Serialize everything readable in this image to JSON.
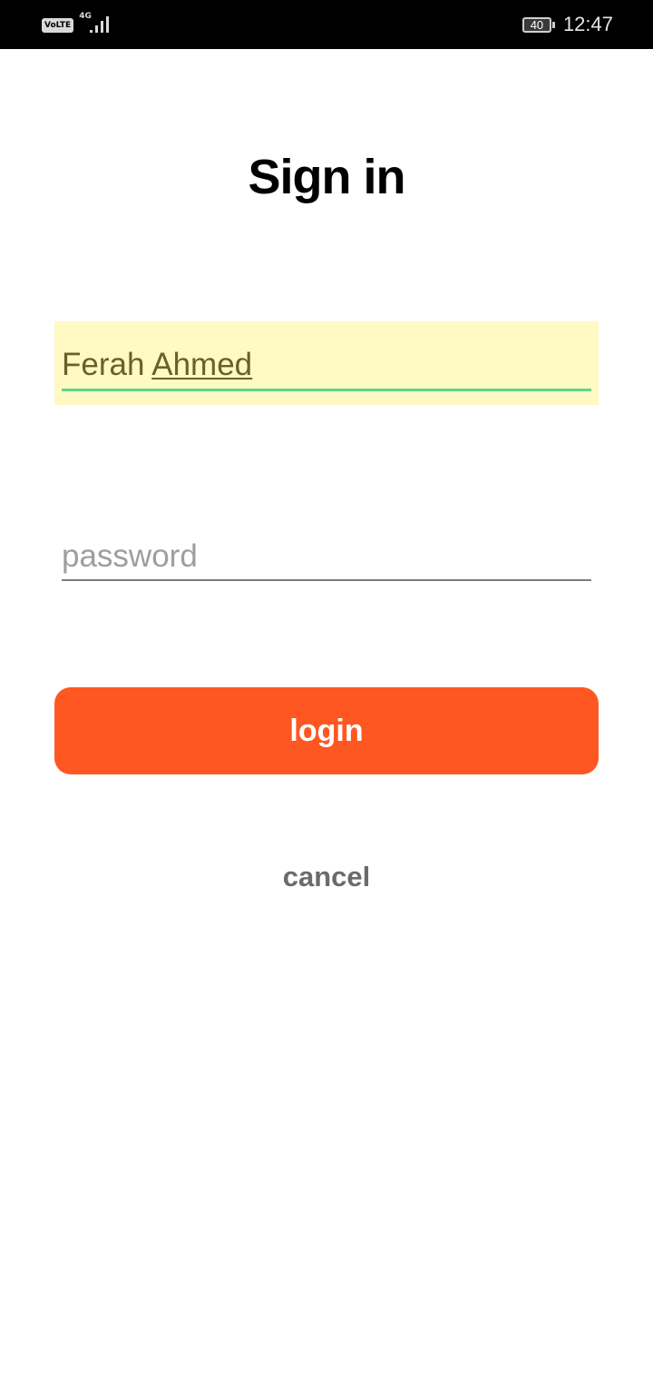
{
  "status_bar": {
    "volte_label": "VoLTE",
    "network_label": "4G",
    "battery_level": "40",
    "time": "12:47",
    "icons": [
      "volte-icon",
      "signal-icon",
      "battery-icon"
    ]
  },
  "screen": {
    "title": "Sign in"
  },
  "form": {
    "username": {
      "value_first": "Ferah",
      "value_last": "Ahmed",
      "background_color": "#fff9c4",
      "focus_line_color": "#5ed68a"
    },
    "password": {
      "value": "",
      "placeholder": "password"
    },
    "login_label": "login",
    "login_color": "#ff5722",
    "cancel_label": "cancel"
  }
}
